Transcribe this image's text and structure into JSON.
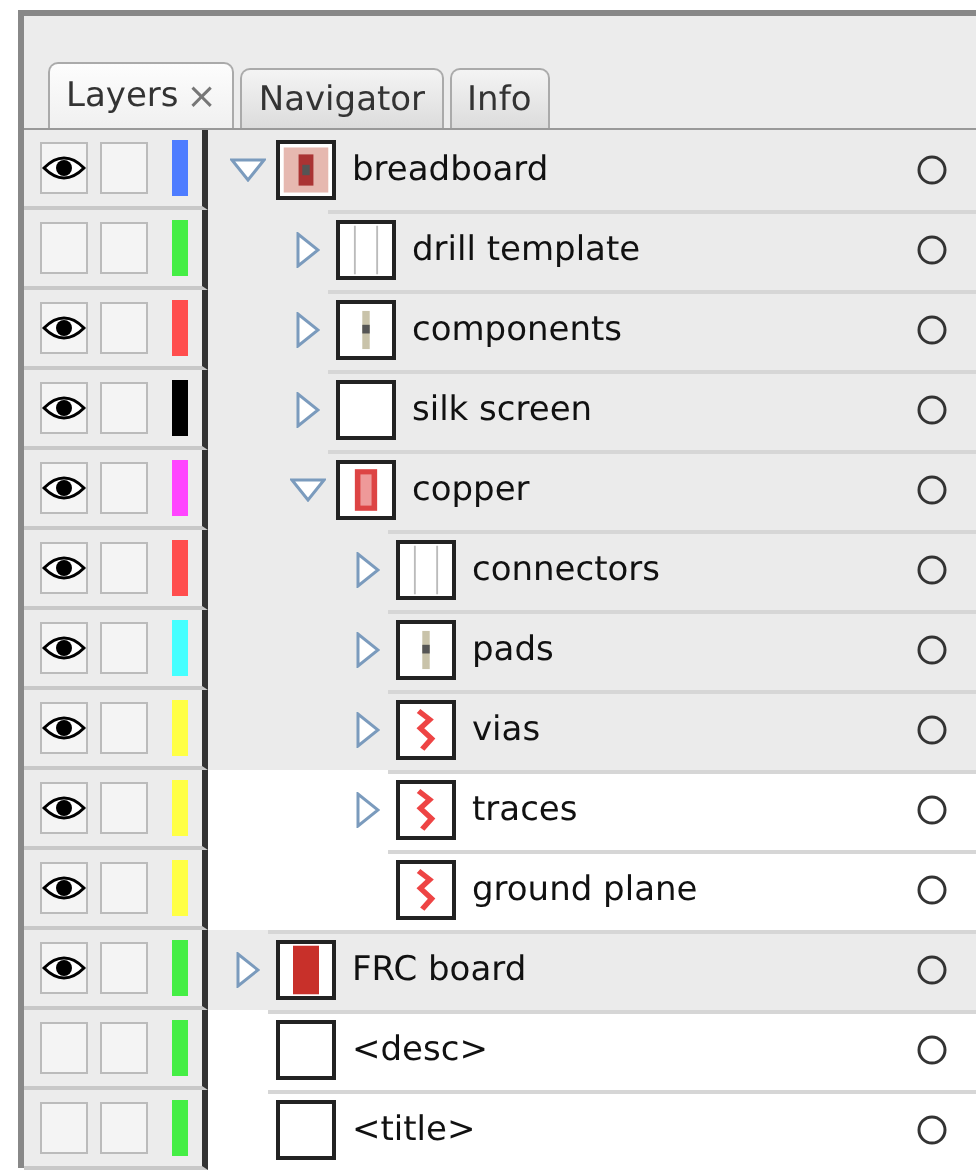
{
  "tabs": [
    {
      "label": "Layers",
      "close": "×",
      "selected": true
    },
    {
      "label": "Navigator",
      "selected": false
    },
    {
      "label": "Info",
      "selected": false
    }
  ],
  "layers": [
    {
      "name": "breadboard",
      "visible": true,
      "locked": false,
      "color": "#4d7cff",
      "expanded": true,
      "highlighted": true,
      "kind": "board",
      "children": [
        {
          "name": "drill template",
          "visible": false,
          "locked": false,
          "color": "#44ee44",
          "expanded": false,
          "highlighted": true,
          "kind": "lines"
        },
        {
          "name": "components",
          "visible": true,
          "locked": false,
          "color": "#ff4d4d",
          "expanded": false,
          "highlighted": true,
          "kind": "part"
        },
        {
          "name": "silk screen",
          "visible": true,
          "locked": false,
          "color": "#000000",
          "expanded": false,
          "highlighted": true,
          "kind": "blank"
        },
        {
          "name": "copper",
          "visible": true,
          "locked": false,
          "color": "#ff44ff",
          "expanded": true,
          "highlighted": true,
          "kind": "copper",
          "children": [
            {
              "name": "connectors",
              "visible": true,
              "locked": false,
              "color": "#ff4d4d",
              "expanded": false,
              "highlighted": true,
              "kind": "lines"
            },
            {
              "name": "pads",
              "visible": true,
              "locked": false,
              "color": "#44ffff",
              "expanded": false,
              "highlighted": true,
              "kind": "part"
            },
            {
              "name": "vias",
              "visible": true,
              "locked": false,
              "color": "#ffff44",
              "expanded": false,
              "highlighted": true,
              "kind": "traces"
            },
            {
              "name": "traces",
              "visible": true,
              "locked": false,
              "color": "#ffff44",
              "expanded": false,
              "highlighted": false,
              "kind": "traces"
            },
            {
              "name": "ground plane",
              "visible": true,
              "locked": false,
              "color": "#ffff44",
              "highlighted": false,
              "kind": "traces"
            }
          ]
        }
      ]
    },
    {
      "name": "FRC board",
      "visible": true,
      "locked": false,
      "color": "#44ee44",
      "expanded": false,
      "highlighted": true,
      "kind": "solid"
    },
    {
      "name": "<desc>",
      "visible": false,
      "locked": false,
      "color": "#44ee44",
      "highlighted": false,
      "kind": "blank"
    },
    {
      "name": "<title>",
      "visible": false,
      "locked": false,
      "color": "#44ee44",
      "highlighted": false,
      "kind": "blank"
    }
  ]
}
